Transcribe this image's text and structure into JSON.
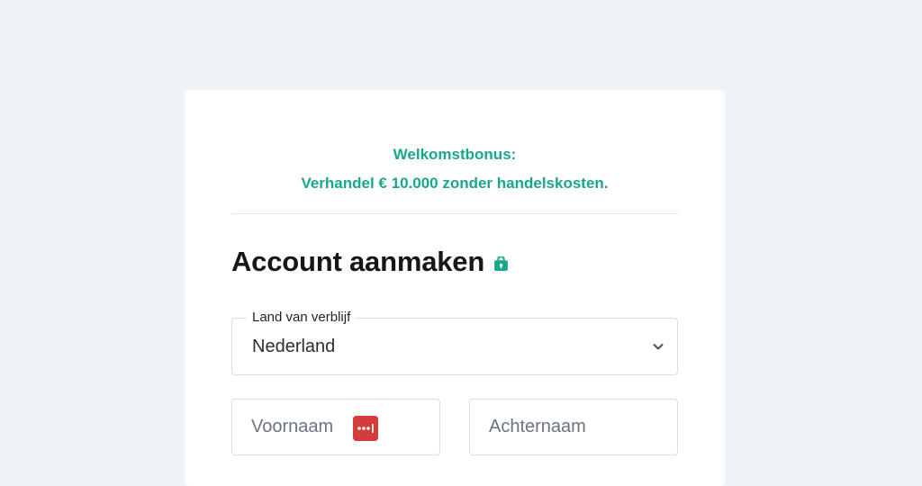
{
  "promo": {
    "line1": "Welkomstbonus:",
    "line2": "Verhandel € 10.000 zonder handelskosten."
  },
  "form": {
    "title": "Account aanmaken",
    "country_label": "Land van verblijf",
    "country_value": "Nederland",
    "first_name_placeholder": "Voornaam",
    "last_name_placeholder": "Achternaam"
  },
  "icons": {
    "title_icon": "lock-icon",
    "select_icon": "chevron-down-icon",
    "password_manager_icon": "password-manager-icon"
  },
  "colors": {
    "accent": "#1aa68b",
    "background": "#eff2f7",
    "password_manager": "#d63b3b"
  }
}
